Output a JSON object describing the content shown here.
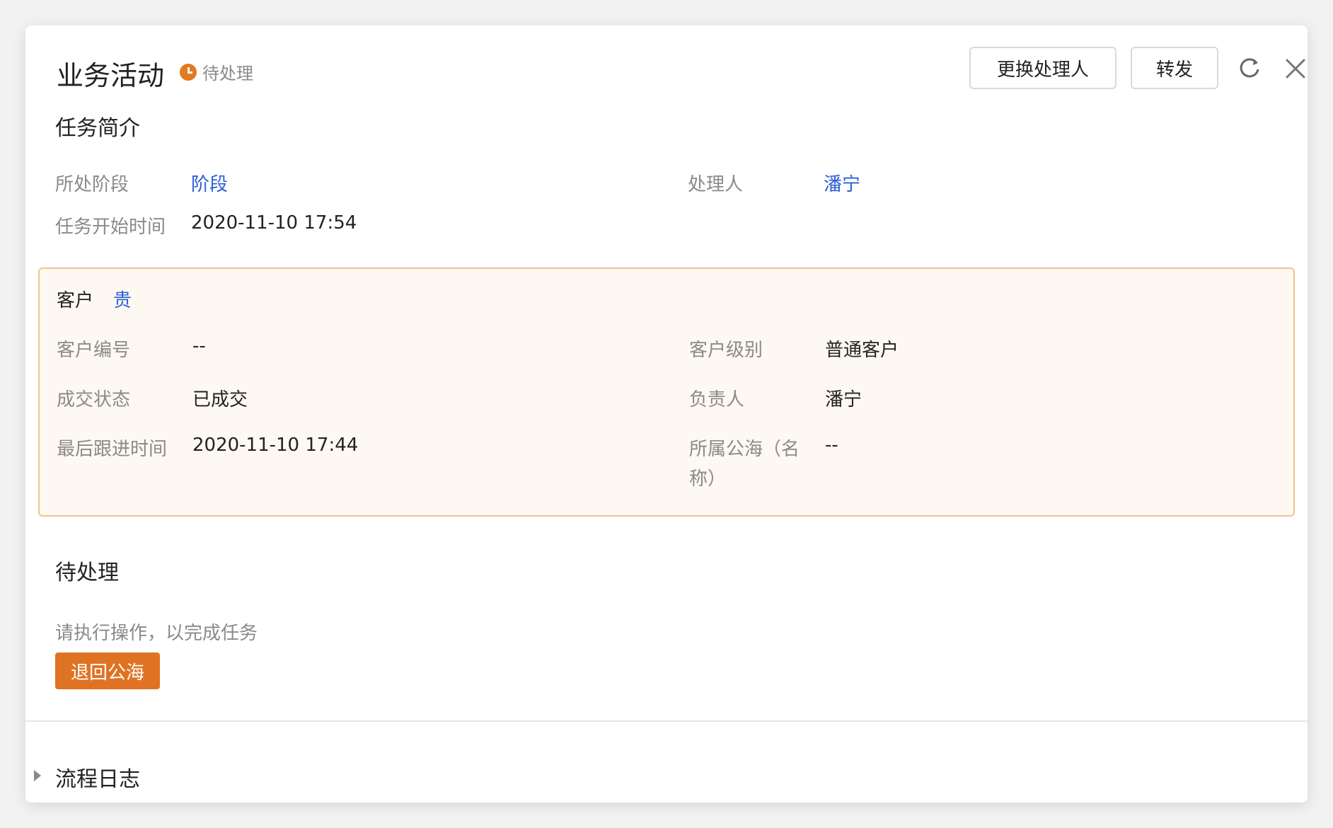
{
  "header": {
    "title": "业务活动",
    "status": "待处理",
    "change_handler_label": "更换处理人",
    "forward_label": "转发"
  },
  "task_summary": {
    "title": "任务简介",
    "stage_label": "所处阶段",
    "stage_value": "阶段",
    "handler_label": "处理人",
    "handler_value": "潘宁",
    "start_time_label": "任务开始时间",
    "start_time_value": "2020-11-10 17:54"
  },
  "customer": {
    "label": "客户",
    "name": "贵",
    "number_label": "客户编号",
    "number_value": "--",
    "level_label": "客户级别",
    "level_value": "普通客户",
    "deal_status_label": "成交状态",
    "deal_status_value": "已成交",
    "owner_label": "负责人",
    "owner_value": "潘宁",
    "last_follow_label": "最后跟进时间",
    "last_follow_value": "2020-11-10 17:44",
    "public_sea_label_line1": "所属公海（名",
    "public_sea_label_line2": "称）",
    "public_sea_value": "--"
  },
  "pending": {
    "title": "待处理",
    "hint": "请执行操作，以完成任务",
    "return_button_label": "退回公海"
  },
  "process_log": {
    "title": "流程日志"
  },
  "colors": {
    "accent": "#e07323",
    "link": "#2a5fd6",
    "customer_border": "#f0c48a",
    "customer_bg": "#fdf8f1"
  },
  "icons": [
    "clock-status-icon",
    "refresh-icon",
    "close-icon",
    "caret-right-icon"
  ]
}
